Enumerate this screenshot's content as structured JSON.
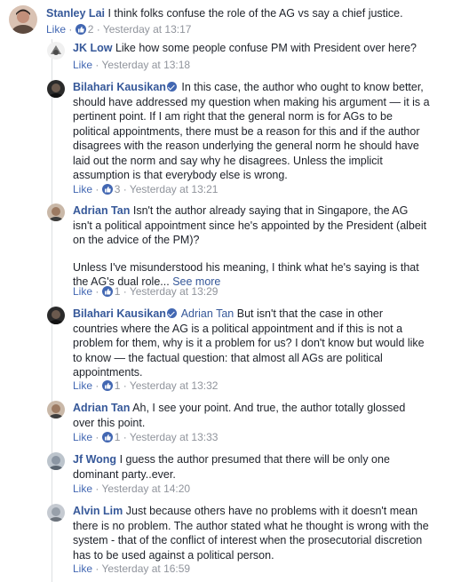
{
  "comments": [
    {
      "author": "Stanley Lai",
      "text": "I think folks confuse the role of the AG vs say a chief justice.",
      "like": "Like",
      "likes": "2",
      "time": "Yesterday at 13:17",
      "avatar_color": "#c28f7a"
    },
    {
      "author": "JK Low",
      "text": "Like how some people confuse PM with President over here?",
      "like": "Like",
      "time": "Yesterday at 13:18",
      "avatar_color": "#e8e8e8"
    },
    {
      "author": "Bilahari Kausikan",
      "text": "In this case, the author who ought to know better, should have addressed my question when making his argument — it is a pertinent point. If I am right that the general norm is for AGs to be political appointments, there must be a reason for this and if the author disagrees with the reason underlying the general norm he should have laid out the norm and say why he disagrees. Unless the implicit assumption is that everybody else is wrong.",
      "like": "Like",
      "likes": "3",
      "time": "Yesterday at 13:21",
      "avatar_color": "#3a3a3a"
    },
    {
      "author": "Adrian Tan",
      "text": "Isn't the author already saying that in Singapore, the AG isn't a political appointment since he's appointed by the President (albeit on the advice of the PM)?",
      "text2": "Unless I've misunderstood his meaning, I think what he's saying is that the AG's dual role...",
      "see_more": "See more",
      "like": "Like",
      "likes": "1",
      "time": "Yesterday at 13:29",
      "avatar_color": "#8a6f5a"
    },
    {
      "author": "Bilahari Kausikan",
      "tag": "Adrian Tan",
      "text": "But isn't that the case in other countries where the AG is a political appointment and if this is not a problem for them, why is it a problem for us? I don't know but would like to know — the factual question: that almost all AGs are political appointments.",
      "like": "Like",
      "likes": "1",
      "time": "Yesterday at 13:32",
      "avatar_color": "#3a3a3a"
    },
    {
      "author": "Adrian Tan",
      "text": "Ah, I see your point. And true, the author totally glossed over this point.",
      "like": "Like",
      "likes": "1",
      "time": "Yesterday at 13:33",
      "avatar_color": "#8a6f5a"
    },
    {
      "author": "Jf Wong",
      "text": "I guess the author presumed that there will be only one dominant party..ever.",
      "like": "Like",
      "time": "Yesterday at 14:20",
      "avatar_color": "#9aa5b1"
    },
    {
      "author": "Alvin Lim",
      "text": "Just because others have no problems with it doesn't mean there is no problem. The author stated what he thought is wrong with the system - that of the conflict of interest when the prosecutorial discretion has to be used against a political person.",
      "like": "Like",
      "time": "Yesterday at 16:59",
      "avatar_color": "#9aa0aa"
    }
  ]
}
